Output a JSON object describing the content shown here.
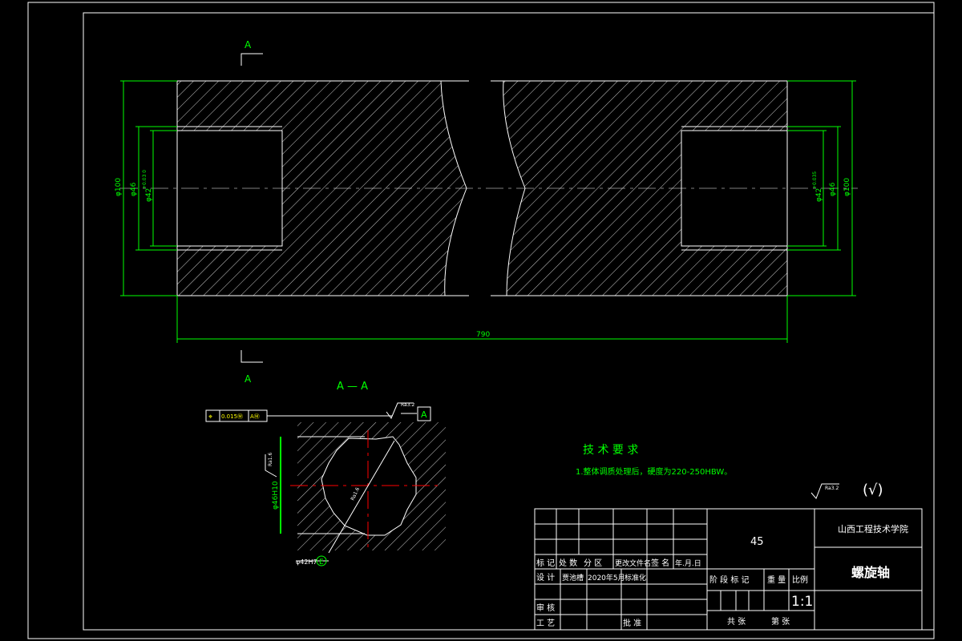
{
  "section_marks": {
    "top": "A",
    "bottom": "A",
    "section_title": "A — A"
  },
  "dimensions": {
    "left_d100": "φ100",
    "left_d46": "φ46",
    "left_d42": "φ42",
    "left_d42_tol": "+0.03 0",
    "right_d100": "φ100",
    "right_d46": "φ46",
    "right_d42": "φ42",
    "right_d42_tol": "+0.035",
    "length": "790",
    "spline_major": "φ46H10",
    "spline_minor": "φ42H7",
    "spline_minor_symbol": "E",
    "roughness_top": "Ra3.2",
    "roughness_side": "Ra1.6",
    "roughness_inner": "Ra1.6"
  },
  "tolerance_frame": {
    "symbol": "⌖",
    "value": "0.015Ⓜ",
    "datum": "AⓂ",
    "datum_label": "A"
  },
  "tech_requirements": {
    "title": "技 术 要 求",
    "item1": "1.整体调质处理后，硬度为220-250HBW。"
  },
  "roughness_general": {
    "label": "Ra3.2",
    "other": "(√)"
  },
  "title_block": {
    "material": "45",
    "school": "山西工程技术学院",
    "part_name": "螺旋轴",
    "scale": "1:1",
    "headers": [
      "标 记",
      "处 数",
      "分 区",
      "更改文件名",
      "签 名",
      "年.月.日"
    ],
    "design_label": "设 计",
    "designer": "贾池槽",
    "date": "2020年5月",
    "standardize": "标准化",
    "review": "审 核",
    "process": "工 艺",
    "approve": "批 准",
    "stage_mark": "阶 段 标 记",
    "weight": "重 量",
    "scale_label": "比例",
    "sheets": "共 张",
    "sheet_no": "第 张"
  },
  "colors": {
    "outline": "#ffffff",
    "dimension": "#00ff00",
    "centerline": "#ff0000",
    "tolerance": "#ffff00"
  }
}
